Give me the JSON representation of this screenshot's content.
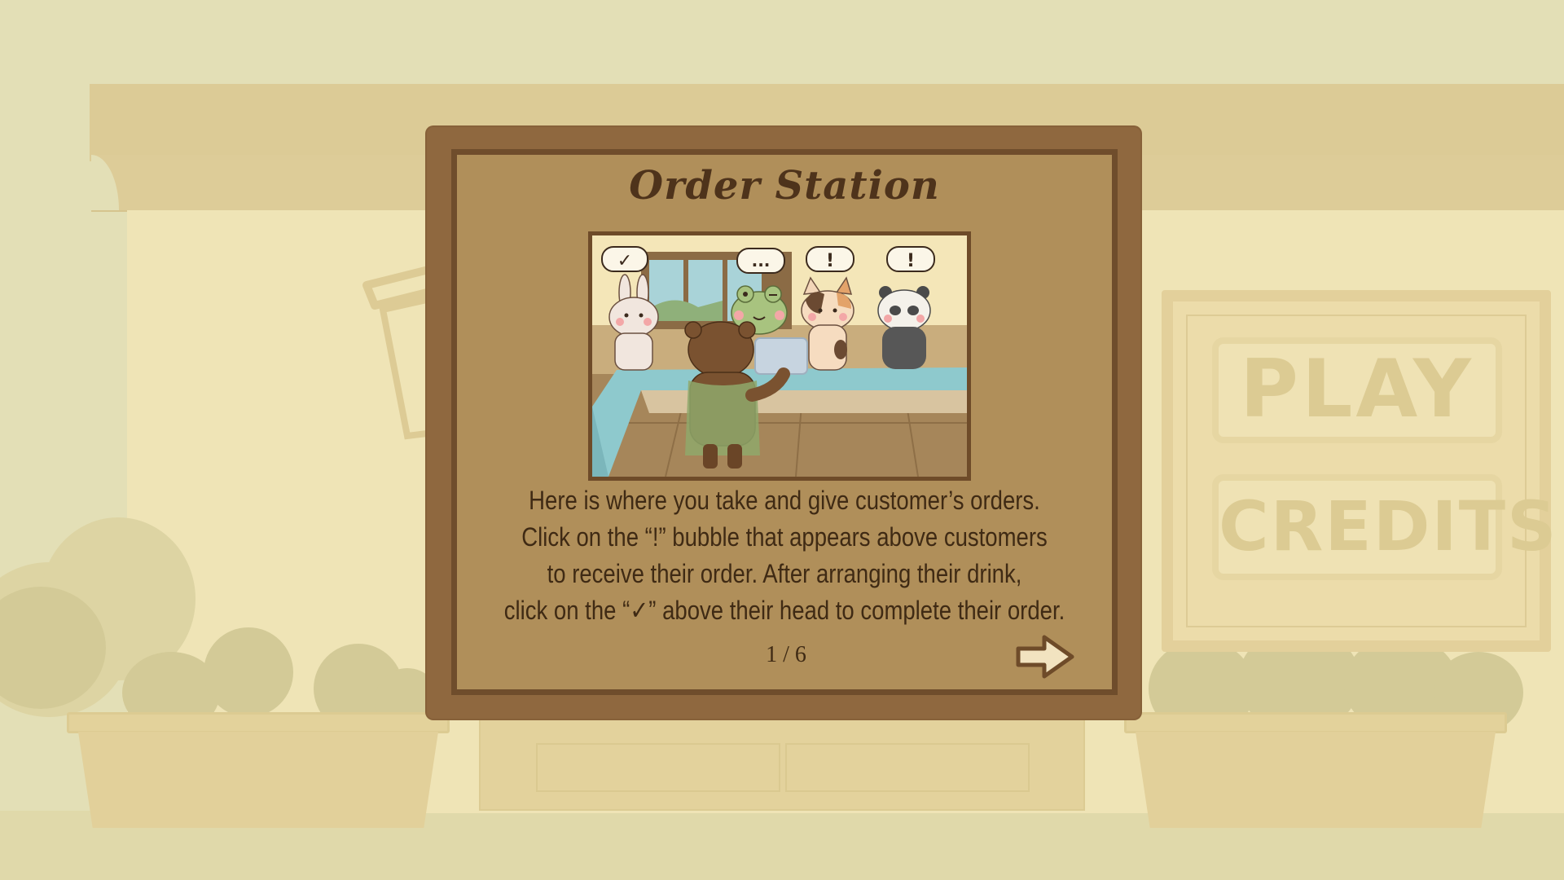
{
  "tutorial": {
    "title": "Order Station",
    "description_lines": [
      "Here is where you take and give customer’s orders.",
      "Click on the “!” bubble that appears above customers",
      "to receive their order. After arranging their drink,",
      "click on the “✓” above their head to complete their order."
    ],
    "page_counter": "1 / 6",
    "next_icon": "arrow-right-icon",
    "illustration": {
      "bubbles": [
        "✓",
        "...",
        "!",
        "!"
      ],
      "customers": [
        "bunny",
        "frog",
        "calico-cat",
        "panda"
      ],
      "barista": "bear"
    }
  },
  "menu": {
    "play_label": "PLAY",
    "credits_label": "CREDITS"
  },
  "colors": {
    "background": "#e3dfb6",
    "panel_frame": "#8f683f",
    "panel_fill": "#b08f5a",
    "text": "#3f2a14",
    "counter_teal": "#8ec9cd"
  }
}
